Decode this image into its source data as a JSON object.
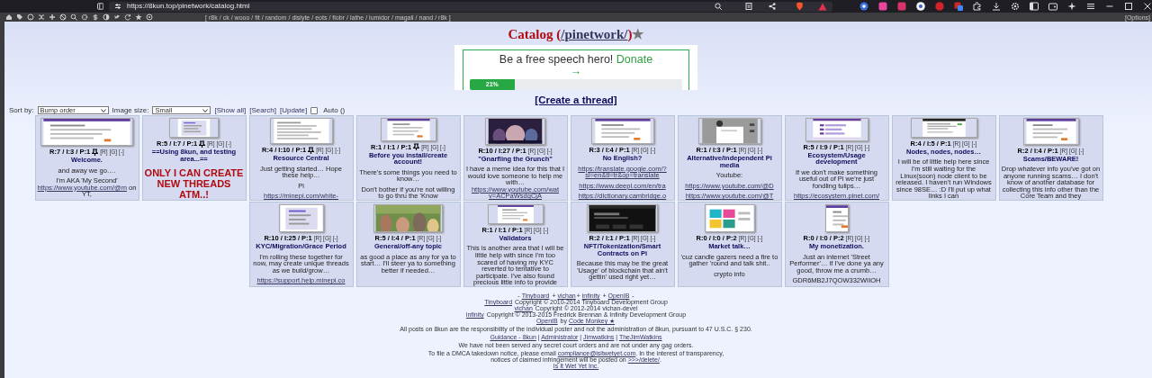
{
  "browser": {
    "url": "https://8kun.top/pinetwork/catalog.html"
  },
  "boardlist": {
    "open": "[",
    "close": "]",
    "separator": "/",
    "boards": [
      "r8k",
      "ck",
      "wooo",
      "fit",
      "random",
      "dislyte",
      "eots",
      "fiobr",
      "lathe",
      "lumidor",
      "magali",
      "nand",
      "r8k"
    ],
    "options": "[Options]"
  },
  "header": {
    "prefix": "Catalog (",
    "board": "/pinetwork/",
    "suffix": ")",
    "star": "★"
  },
  "donation": {
    "text": "Be a free speech hero!",
    "link": "Donate",
    "arrow": "→",
    "level": 0.21,
    "reading": "21%"
  },
  "create_thread": "[Create a thread]",
  "controls": {
    "sort_label": "Sort by:",
    "sort_value": "Bump order",
    "size_label": "Image size:",
    "size_value": "Small",
    "links": [
      "[Show all]",
      "[Search]",
      "[Update]"
    ],
    "auto_checked": false,
    "auto_label": "Auto ()"
  },
  "threads": [
    {
      "stats": "R:7 / I:3 / P:1",
      "pinned": true,
      "actions": [
        "[R]",
        "[G]",
        "[-]"
      ],
      "subject": "Welcome.",
      "body": [
        [
          {
            "kind": "text",
            "text": "and away we go…."
          }
        ],
        [
          {
            "kind": "text",
            "text": "I'm AKA 'My Second' "
          },
          {
            "kind": "link",
            "text": "https://www.youtube.com/@m"
          },
          {
            "kind": "text",
            "text": " on YT,"
          }
        ]
      ]
    },
    {
      "stats": "R:5 / I:7 / P:1",
      "pinned": true,
      "actions": [
        "[R]",
        "[G]",
        "[-]"
      ],
      "subject": "==Using 8kun, and testing area...==",
      "body": [
        [
          {
            "kind": "heading",
            "text": "ONLY I CAN CREATE NEW THREADS ATM..!"
          }
        ]
      ]
    },
    {
      "stats": "R:4 / I:10 / P:1",
      "pinned": true,
      "actions": [
        "[R]",
        "[G]",
        "[-]"
      ],
      "subject": "Resource Central",
      "body": [
        [
          {
            "kind": "text",
            "text": "Just getting started… Hope these help…"
          }
        ],
        [
          {
            "kind": "text",
            "text": "Pi"
          }
        ],
        [
          {
            "kind": "link",
            "text": "https://minepi.com/white-"
          }
        ]
      ]
    },
    {
      "stats": "R:1 / I:1 / P:1",
      "pinned": true,
      "actions": [
        "[R]",
        "[G]",
        "[-]"
      ],
      "subject": "Before you install/create account!",
      "body": [
        [
          {
            "kind": "text",
            "text": "There's some things you need to know…"
          }
        ],
        [
          {
            "kind": "text",
            "text": "Don't bother if you're not willing to go thru the 'Know"
          }
        ]
      ]
    },
    {
      "stats": "R:10 / I:27 / P:1",
      "pinned": false,
      "actions": [
        "[R]",
        "[G]",
        "[-]"
      ],
      "subject": "\"Gnarfling the Grunch\"",
      "body": [
        [
          {
            "kind": "text",
            "text": "I have a meme idea for this that I would love someone to help me with… "
          },
          {
            "kind": "link",
            "text": "https://www.youtube.com/wat"
          },
          {
            "kind": "break"
          },
          {
            "kind": "link",
            "text": "v=ACPaWsdqCjA"
          }
        ]
      ]
    },
    {
      "stats": "R:3 / I:4 / P:1",
      "pinned": false,
      "actions": [
        "[R]",
        "[G]",
        "[-]"
      ],
      "subject": "No English?",
      "body": [
        [
          {
            "kind": "link",
            "text": "https://translate.google.com/?"
          },
          {
            "kind": "break"
          },
          {
            "kind": "link",
            "text": "sl=en&tl=tr&op=translate"
          }
        ],
        [
          {
            "kind": "link",
            "text": "https://www.deepl.com/en/tra"
          }
        ],
        [
          {
            "kind": "link",
            "text": "https://dictionary.cambridge.o"
          }
        ]
      ]
    },
    {
      "stats": "R:1 / I:3 / P:1",
      "pinned": false,
      "actions": [
        "[R]",
        "[G]",
        "[-]"
      ],
      "subject": "Alternative/independent Pi media",
      "body": [
        [
          {
            "kind": "text",
            "text": "Youtube:"
          }
        ],
        [
          {
            "kind": "link",
            "text": "https://www.youtube.com/@D"
          }
        ],
        [
          {
            "kind": "link",
            "text": "https://www.youtube.com/@T"
          }
        ]
      ]
    },
    {
      "stats": "R:5 / I:9 / P:1",
      "pinned": false,
      "actions": [
        "[R]",
        "[G]",
        "[-]"
      ],
      "subject": "Ecosystem/Usage development",
      "body": [
        [
          {
            "kind": "text",
            "text": "If we don't make something useful out of Pi we're just fondling tulips…"
          }
        ],
        [
          {
            "kind": "link",
            "text": "https://ecosystem.pinet.com/"
          }
        ]
      ]
    },
    {
      "stats": "R:4 / I:5 / P:1",
      "pinned": false,
      "actions": [
        "[R]",
        "[G]",
        "[-]"
      ],
      "subject": "Nodes, nodes, nodes…",
      "body": [
        [
          {
            "kind": "text",
            "text": "I will be of little help here since I'm still waiting for the Linux(soon) node client to be released. I haven't run Windows since 98SE… :D I'll put up what links I can"
          }
        ]
      ]
    },
    {
      "stats": "R:2 / I:4 / P:1",
      "pinned": false,
      "actions": [
        "[R]",
        "[G]",
        "[-]"
      ],
      "subject": "Scams/BEWARE!",
      "body": [
        [
          {
            "kind": "text",
            "text": "Drop whatever info you've got on anyone running scams… I don't know of another database for collecting this info other than the Core Team and they"
          }
        ]
      ]
    },
    {
      "stats": "R:10 / I:25 / P:1",
      "pinned": false,
      "actions": [
        "[R]",
        "[G]",
        "[-]"
      ],
      "subject": "KYC/Migration/Grace Period",
      "body": [
        [
          {
            "kind": "text",
            "text": "I'm rolling these together for now, may create unique threads as we build/grow…"
          }
        ],
        [
          {
            "kind": "link",
            "text": "https://support.help.minepi.co"
          }
        ]
      ]
    },
    {
      "stats": "R:5 / I:4 / P:1",
      "pinned": false,
      "actions": [
        "[R]",
        "[G]",
        "[-]"
      ],
      "subject": "General/off-any topic",
      "body": [
        [
          {
            "kind": "text",
            "text": "as good a place as any for ya to start… I'll steer ya to something better if needed…"
          }
        ]
      ]
    },
    {
      "stats": "R:1 / I:1 / P:1",
      "pinned": false,
      "actions": [
        "[R]",
        "[G]",
        "[-]"
      ],
      "subject": "Validators",
      "body": [
        [
          {
            "kind": "text",
            "text": "This is another area that I will be little help with since I'm too scared of having my KYC reverted to tentative to participate. I've also found precious little info to provide"
          }
        ]
      ]
    },
    {
      "stats": "R:2 / I:1 / P:1",
      "pinned": false,
      "actions": [
        "[R]",
        "[G]",
        "[-]"
      ],
      "subject": "NFT/Tokenization/Smart Contracts on Pi",
      "body": [
        [
          {
            "kind": "text",
            "text": "Because this may be the great 'Usage' of blockchain that ain't gettin' used right yet…"
          }
        ]
      ]
    },
    {
      "stats": "R:0 / I:0 / P:2",
      "pinned": false,
      "actions": [
        "[R]",
        "[G]",
        "[-]"
      ],
      "subject": "Market talk…",
      "body": [
        [
          {
            "kind": "text",
            "text": "'cuz candle gazers need a fire to gather 'round and talk shit.."
          }
        ],
        [
          {
            "kind": "text",
            "text": "crypto info"
          }
        ]
      ]
    },
    {
      "stats": "R:0 / I:0 / P:2",
      "pinned": false,
      "actions": [
        "[R]",
        "[G]",
        "[-]"
      ],
      "subject": "My monetization.",
      "body": [
        [
          {
            "kind": "text",
            "text": "Just an internet 'Street Performer'… if I've done ya any good, throw me a crumb…"
          }
        ],
        [
          {
            "kind": "text",
            "text": "GDR6MB2J7QOW332WIIOH"
          }
        ]
      ]
    }
  ],
  "footer": [
    [
      {
        "kind": "text",
        "text": "- "
      },
      {
        "kind": "link",
        "text": "Tinyboard"
      },
      {
        "kind": "text",
        "text": " + "
      },
      {
        "kind": "link",
        "text": "vichan"
      },
      {
        "kind": "text",
        "text": "+ "
      },
      {
        "kind": "link",
        "text": "infinity"
      },
      {
        "kind": "text",
        "text": " + "
      },
      {
        "kind": "link",
        "text": "OpenIB"
      },
      {
        "kind": "text",
        "text": " -"
      }
    ],
    [
      {
        "kind": "link",
        "text": "Tinyboard"
      },
      {
        "kind": "text",
        "text": " Copyright © 2010-2014 Tinyboard Development Group"
      }
    ],
    [
      {
        "kind": "link",
        "text": "vichan"
      },
      {
        "kind": "text",
        "text": " Copyright © 2012-2014 vichan-devel"
      }
    ],
    [
      {
        "kind": "link",
        "text": "infinity"
      },
      {
        "kind": "text",
        "text": " Copyright © 2013-2015 Fredrick Brennan & Infinity Development Group"
      }
    ],
    [
      {
        "kind": "link",
        "text": "OpenIB"
      },
      {
        "kind": "text",
        "text": " by "
      },
      {
        "kind": "link",
        "text": "Code Monkey ★"
      }
    ]
  ],
  "notices": [
    [
      {
        "kind": "text",
        "text": "All posts on 8kun are the responsibility of the individual poster and not the administration of 8kun, pursuant to 47 U.S.C. § 230."
      }
    ],
    [
      {
        "kind": "link",
        "text": "Guidance - 8kun"
      },
      {
        "kind": "text",
        "text": " | "
      },
      {
        "kind": "link",
        "text": "Administrator"
      },
      {
        "kind": "text",
        "text": " | "
      },
      {
        "kind": "link",
        "text": "Jimwatkins"
      },
      {
        "kind": "text",
        "text": " | "
      },
      {
        "kind": "link",
        "text": "TheJimWatkins"
      }
    ],
    [
      {
        "kind": "text",
        "text": "We have not been served any secret court orders and are not under any gag orders."
      }
    ],
    [
      {
        "kind": "text",
        "text": "To file a DMCA takedown notice, please email "
      },
      {
        "kind": "link",
        "text": "compliance@isitwetyet.com"
      },
      {
        "kind": "text",
        "text": ". In the interest of transparency, notices of claimed infringement will be posted on "
      },
      {
        "kind": "link",
        "text": ">>>/delete/"
      },
      {
        "kind": "text",
        "text": "."
      },
      {
        "kind": "break"
      },
      {
        "kind": "link",
        "text": "Is It Wet Yet Inc."
      }
    ]
  ]
}
